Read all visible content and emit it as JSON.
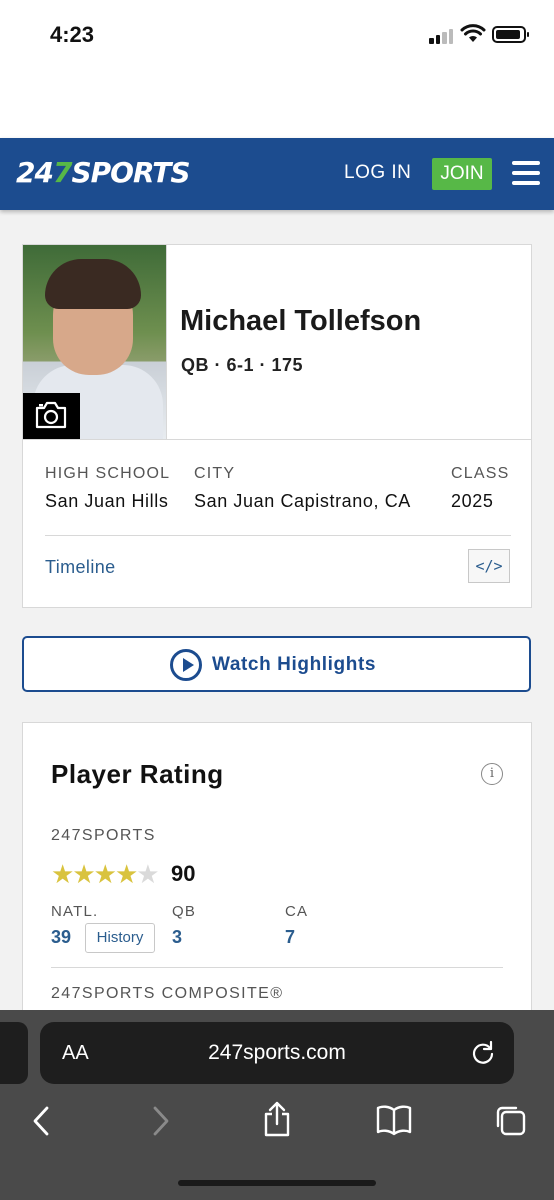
{
  "status_bar": {
    "time": "4:23"
  },
  "header": {
    "logo_prefix": "24",
    "logo_seven": "7",
    "logo_suffix": "SPORTS",
    "login_label": "LOG IN",
    "join_label": "JOIN",
    "colors": {
      "brand_blue": "#1c4c8f",
      "join_green": "#57b847"
    }
  },
  "player": {
    "name": "Michael Tollefson",
    "meta": "QB · 6-1 · 175",
    "labels": {
      "high_school": "HIGH SCHOOL",
      "city": "CITY",
      "class": "CLASS"
    },
    "values": {
      "high_school": "San Juan Hills",
      "city": "San Juan Capistrano, CA",
      "class": "2025"
    },
    "timeline_label": "Timeline",
    "embed_label": "</>"
  },
  "highlights": {
    "label": "Watch Highlights"
  },
  "rating": {
    "title": "Player Rating",
    "info_icon": "i",
    "source_label": "247SPORTS",
    "stars_filled": 4,
    "stars_total": 5,
    "score": "90",
    "ranks": [
      {
        "label": "NATL.",
        "value": "39"
      },
      {
        "label": "QB",
        "value": "3"
      },
      {
        "label": "CA",
        "value": "7"
      }
    ],
    "history_label": "History",
    "composite_label": "247SPORTS COMPOSITE®"
  },
  "browser": {
    "aa_label": "AA",
    "url": "247sports.com"
  }
}
